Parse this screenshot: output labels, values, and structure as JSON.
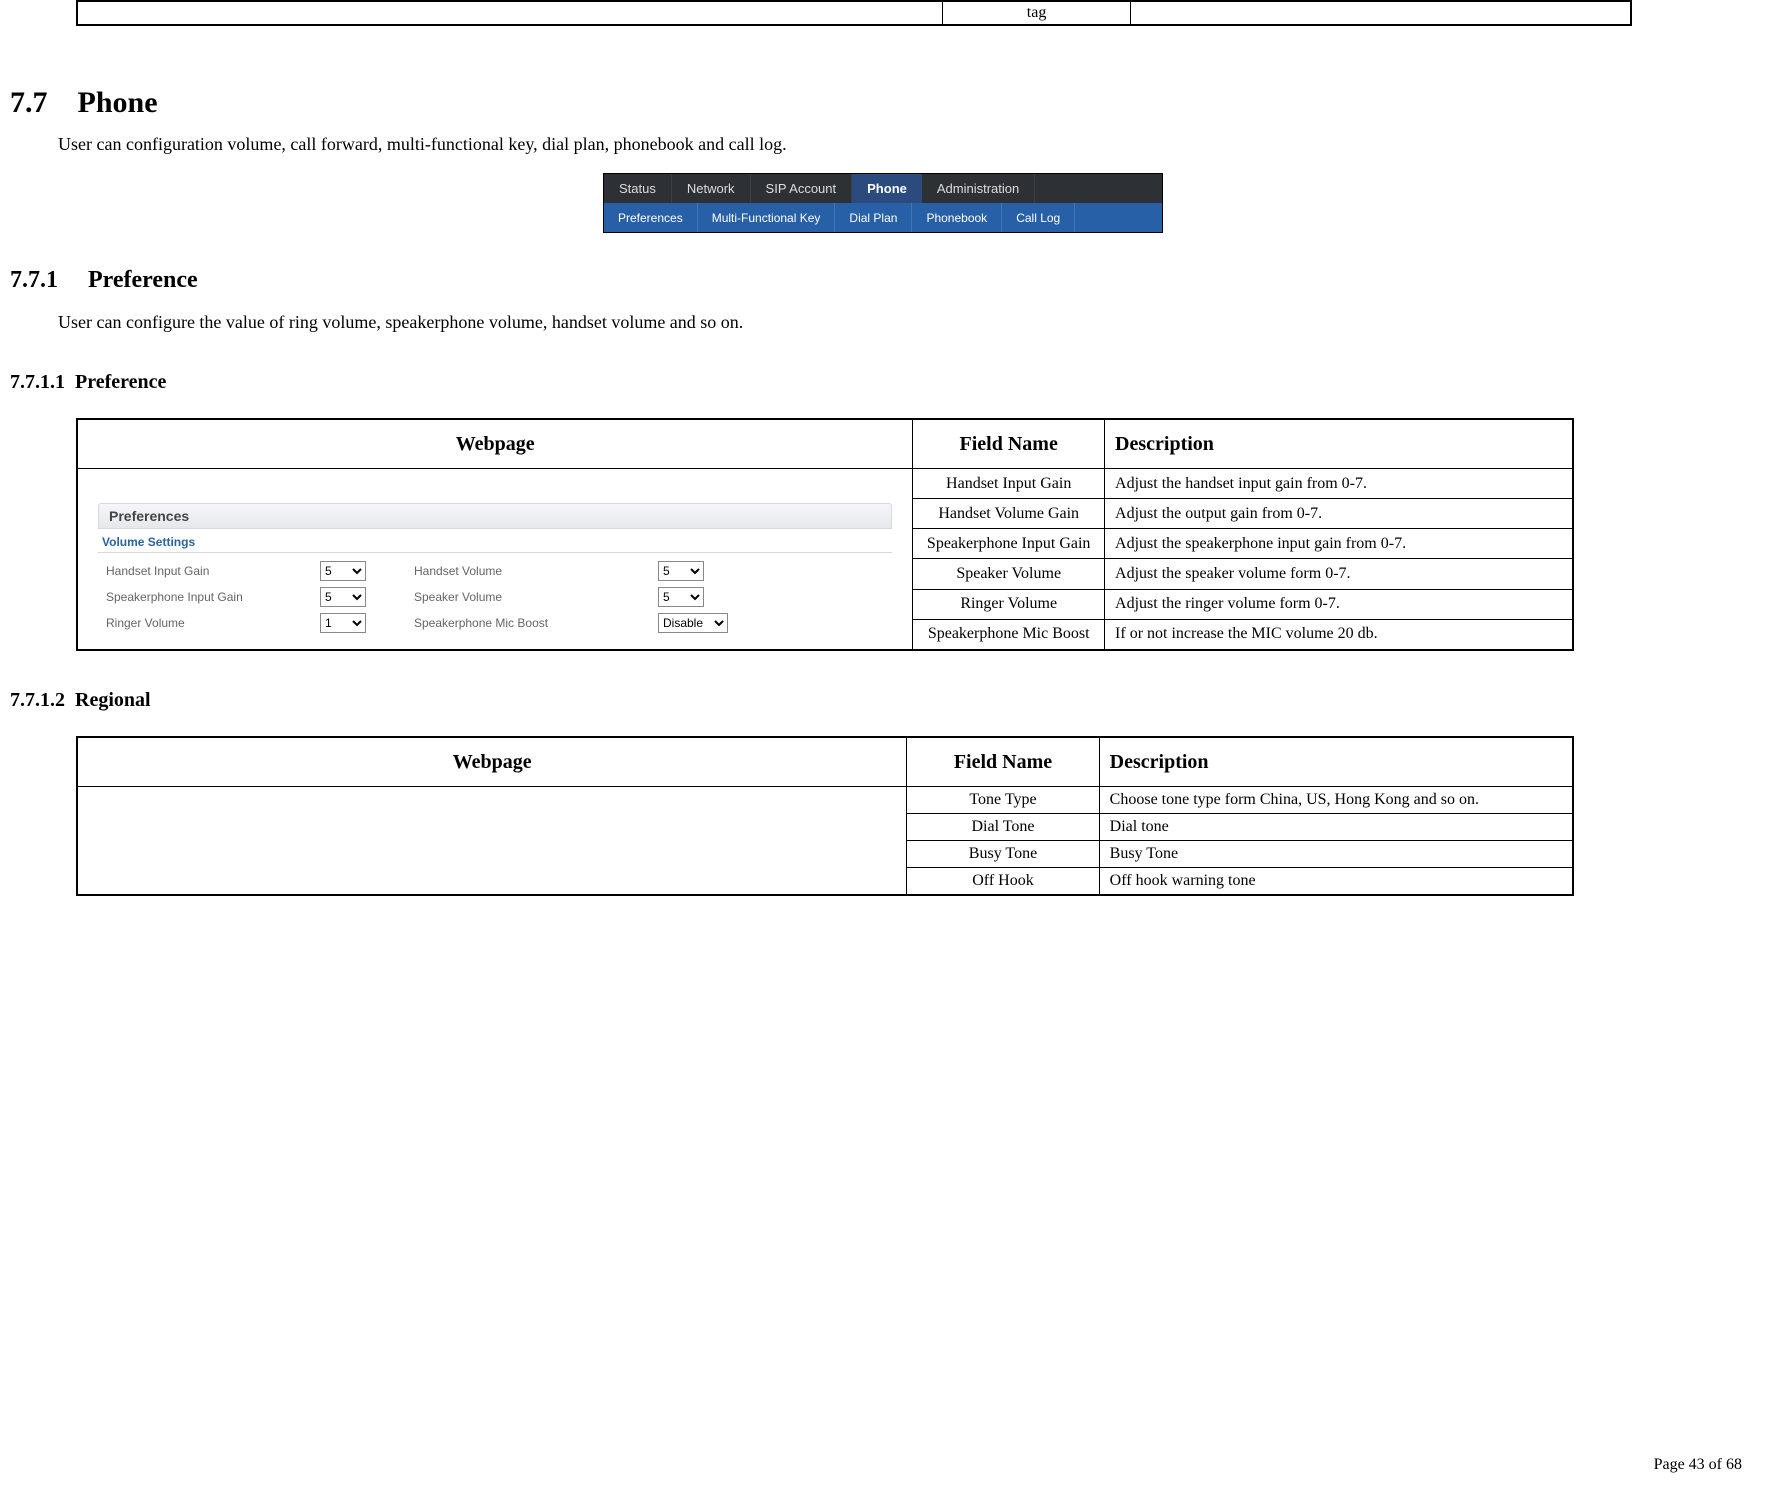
{
  "top_row": {
    "tag": "tag"
  },
  "section_7_7": {
    "number": "7.7",
    "title": "Phone",
    "intro": "User can configuration volume, call forward, multi-functional key, dial plan, phonebook and call log."
  },
  "tabs": {
    "top": [
      "Status",
      "Network",
      "SIP Account",
      "Phone",
      "Administration"
    ],
    "active_top_index": 3,
    "sub": [
      "Preferences",
      "Multi-Functional Key",
      "Dial Plan",
      "Phonebook",
      "Call Log"
    ],
    "active_sub_index": 0
  },
  "section_7_7_1": {
    "number": "7.7.1",
    "title": "Preference",
    "intro": "User can configure the value of ring volume, speakerphone volume, handset volume and so on."
  },
  "section_7_7_1_1": {
    "number": "7.7.1.1",
    "title": "Preference"
  },
  "pref_table": {
    "headers": {
      "webpage": "Webpage",
      "fieldname": "Field Name",
      "description": "Description"
    },
    "rows": [
      {
        "field": "Handset Input Gain",
        "desc": "Adjust the handset input gain from 0-7."
      },
      {
        "field": "Handset Volume Gain",
        "desc": "Adjust the output gain from 0-7."
      },
      {
        "field": "Speakerphone Input Gain",
        "desc": "Adjust the speakerphone input gain from 0-7."
      },
      {
        "field": "Speaker Volume",
        "desc": "Adjust the speaker volume form 0-7."
      },
      {
        "field": "Ringer Volume",
        "desc": "Adjust the ringer volume form 0-7."
      },
      {
        "field": "Speakerphone Mic Boost",
        "desc": "If or not increase the MIC volume 20 db."
      }
    ]
  },
  "webui": {
    "panel_title": "Preferences",
    "section_title": "Volume Settings",
    "fields": {
      "handset_input_gain": {
        "label": "Handset Input Gain",
        "value": "5"
      },
      "handset_volume": {
        "label": "Handset Volume",
        "value": "5"
      },
      "speakerphone_input_gain": {
        "label": "Speakerphone Input Gain",
        "value": "5"
      },
      "speaker_volume": {
        "label": "Speaker Volume",
        "value": "5"
      },
      "ringer_volume": {
        "label": "Ringer Volume",
        "value": "1"
      },
      "speakerphone_mic_boost": {
        "label": "Speakerphone Mic Boost",
        "value": "Disable"
      }
    }
  },
  "section_7_7_1_2": {
    "number": "7.7.1.2",
    "title": "Regional"
  },
  "regional_table": {
    "headers": {
      "webpage": "Webpage",
      "fieldname": "Field Name",
      "description": "Description"
    },
    "rows": [
      {
        "field": "Tone Type",
        "desc": "Choose tone type form China, US, Hong Kong and so on."
      },
      {
        "field": "Dial Tone",
        "desc": "Dial tone"
      },
      {
        "field": "Busy Tone",
        "desc": "Busy Tone"
      },
      {
        "field": "Off Hook",
        "desc": "Off hook warning tone"
      }
    ]
  },
  "footer": "Page  43  of  68"
}
